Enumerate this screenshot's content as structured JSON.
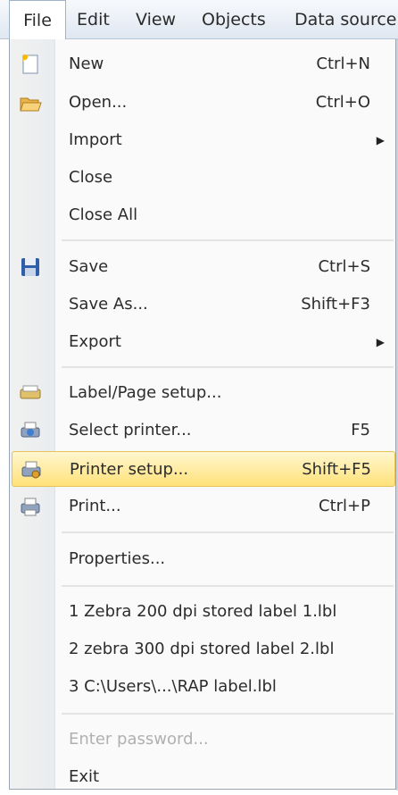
{
  "menubar": {
    "file": "File",
    "edit": "Edit",
    "view": "View",
    "objects": "Objects",
    "datasource": "Data source"
  },
  "menu": {
    "new": {
      "label": "New",
      "shortcut": "Ctrl+N",
      "icon": "new-file-icon"
    },
    "open": {
      "label": "Open...",
      "shortcut": "Ctrl+O",
      "icon": "open-folder-icon"
    },
    "import": {
      "label": "Import"
    },
    "close": {
      "label": "Close"
    },
    "close_all": {
      "label": "Close All"
    },
    "save": {
      "label": "Save",
      "shortcut": "Ctrl+S",
      "icon": "floppy-disk-icon"
    },
    "save_as": {
      "label": "Save As...",
      "shortcut": "Shift+F3"
    },
    "export": {
      "label": "Export"
    },
    "label_page_setup": {
      "label": "Label/Page setup...",
      "icon": "label-setup-icon"
    },
    "select_printer": {
      "label": "Select printer...",
      "shortcut": "F5",
      "icon": "select-printer-icon"
    },
    "printer_setup": {
      "label": "Printer setup...",
      "shortcut": "Shift+F5",
      "icon": "printer-setup-icon"
    },
    "print": {
      "label": "Print...",
      "shortcut": "Ctrl+P",
      "icon": "printer-icon"
    },
    "properties": {
      "label": "Properties..."
    },
    "recent1": {
      "label": "1 Zebra 200 dpi stored label 1.lbl"
    },
    "recent2": {
      "label": "2 zebra 300 dpi stored label 2.lbl"
    },
    "recent3": {
      "label": "3 C:\\Users\\...\\RAP label.lbl"
    },
    "enter_password": {
      "label": "Enter password..."
    },
    "exit": {
      "label": "Exit"
    }
  },
  "colors": {
    "highlight": "#ffe27a",
    "menubar": "#dfe7f1",
    "disabled_text": "#b0b0b0"
  }
}
